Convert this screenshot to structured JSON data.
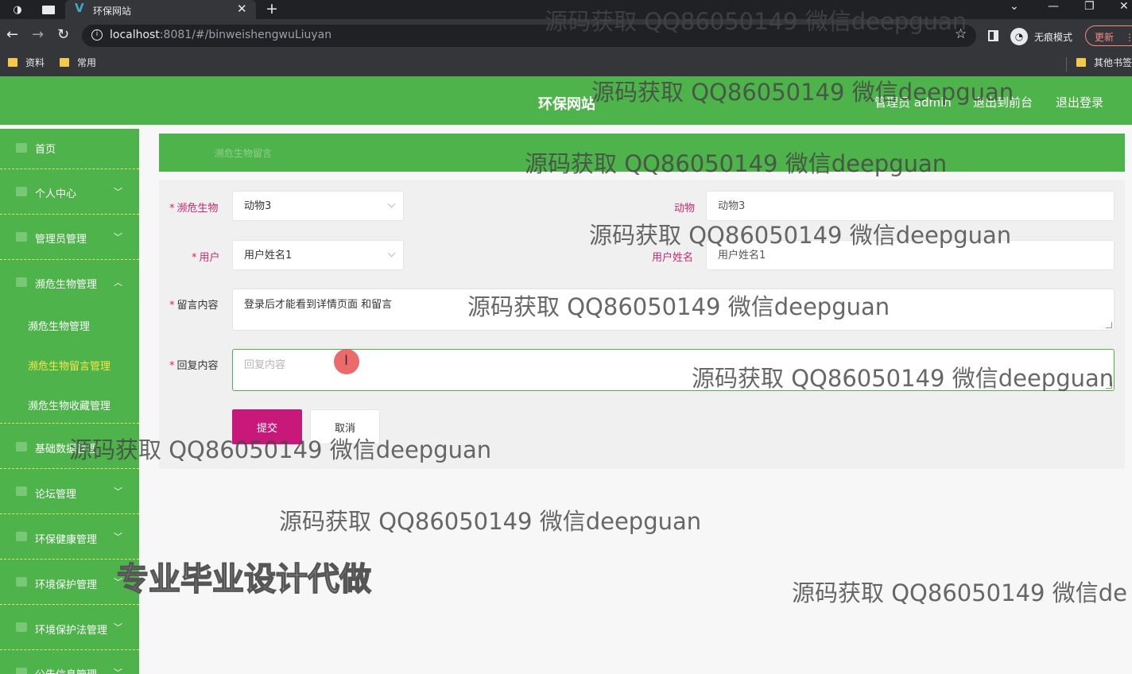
{
  "browser": {
    "tab_title": "环保网站",
    "url_host": "localhost",
    "url_rest": ":8081/#/binweishengwuLiuyan",
    "incognito_label": "无痕模式",
    "update_label": "更新",
    "bookmarks": [
      "资料",
      "常用"
    ],
    "other_bookmarks": "其他书签"
  },
  "header": {
    "site_title": "环保网站",
    "admin_label": "管理员 admin",
    "to_front": "退出到前台",
    "logout": "退出登录"
  },
  "sidebar": {
    "items": [
      {
        "label": "首页",
        "arrow": ""
      },
      {
        "label": "个人中心",
        "arrow": "﹀"
      },
      {
        "label": "管理员管理",
        "arrow": "﹀"
      },
      {
        "label": "濒危生物管理",
        "arrow": "︿"
      },
      {
        "label": "基础数据管理",
        "arrow": ""
      },
      {
        "label": "论坛管理",
        "arrow": "﹀"
      },
      {
        "label": "环保健康管理",
        "arrow": "﹀"
      },
      {
        "label": "环境保护管理",
        "arrow": "﹀"
      },
      {
        "label": "环境保护法管理",
        "arrow": "﹀"
      },
      {
        "label": "公告信息管理",
        "arrow": "﹀"
      }
    ],
    "subitems": [
      "濒危生物管理",
      "濒危生物留言管理",
      "濒危生物收藏管理"
    ],
    "active_subitem": "濒危生物留言管理"
  },
  "breadcrumb": "濒危生物留言",
  "form": {
    "species_label": "濒危生物",
    "species_value": "动物3",
    "animal_label": "动物",
    "animal_value": "动物3",
    "user_label": "用户",
    "user_value": "用户姓名1",
    "username_label": "用户姓名",
    "username_value": "用户姓名1",
    "message_label": "留言内容",
    "message_value": "登录后才能看到详情页面  和留言",
    "reply_label": "回复内容",
    "reply_placeholder": "回复内容",
    "submit_label": "提交",
    "cancel_label": "取消"
  },
  "watermarks": {
    "contact": "源码获取 QQ86050149 微信deepguan",
    "contact_cut": "源码获取 QQ86050149 微信de",
    "promo": "专业毕业设计代做"
  }
}
